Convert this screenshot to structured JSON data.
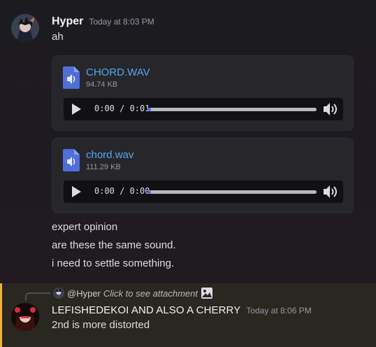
{
  "message1": {
    "username": "Hyper",
    "timestamp": "Today at 8:03 PM",
    "text_top": "ah",
    "attachments": [
      {
        "filename": "CHORD.WAV",
        "size": "94.74 KB",
        "time": "0:00 / 0:01",
        "progress": 0.02
      },
      {
        "filename": "chord.wav",
        "size": "111.29 KB",
        "time": "0:00 / 0:00",
        "progress": 0.02
      }
    ],
    "lines": [
      "expert opinion",
      "are these the same sound.",
      "i need to settle something."
    ]
  },
  "message2": {
    "reply_user": "@Hyper",
    "reply_text": "Click to see attachment",
    "username": "LEFISHEDEKOI AND ALSO A CHERRY",
    "timestamp": "Today at 8:06 PM",
    "text": "2nd is more distorted"
  },
  "colors": {
    "link": "#59a7f0",
    "highlight_bar": "#f0b232",
    "accent": "#5865f2"
  },
  "icons": {
    "file": "audio-file-icon",
    "play": "play-icon",
    "volume": "volume-icon",
    "image": "image-icon"
  }
}
